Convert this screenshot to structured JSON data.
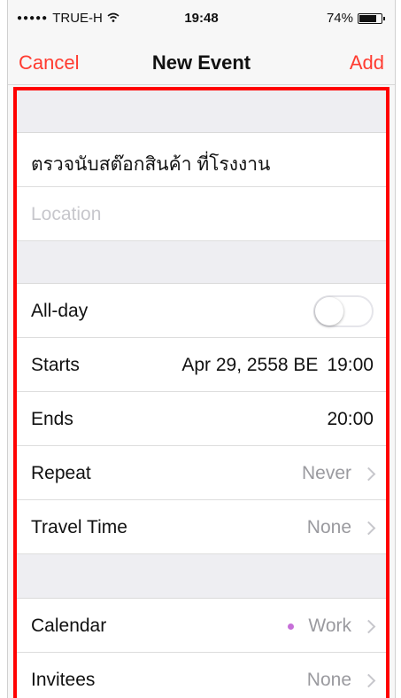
{
  "status_bar": {
    "carrier": "TRUE-H",
    "time": "19:48",
    "battery_percent": "74%",
    "battery_level": 0.74
  },
  "nav": {
    "cancel": "Cancel",
    "title": "New Event",
    "add": "Add"
  },
  "event": {
    "title": "ตรวจนับสต๊อกสินค้า ที่โรงงาน",
    "location_placeholder": "Location"
  },
  "fields": {
    "allday": {
      "label": "All-day",
      "toggle_on": false
    },
    "starts": {
      "label": "Starts",
      "date": "Apr 29, 2558 BE",
      "time": "19:00"
    },
    "ends": {
      "label": "Ends",
      "time": "20:00"
    },
    "repeat": {
      "label": "Repeat",
      "value": "Never"
    },
    "travel": {
      "label": "Travel Time",
      "value": "None"
    },
    "calendar": {
      "label": "Calendar",
      "value": "Work",
      "dot_color": "#c66fd8"
    },
    "invitees": {
      "label": "Invitees",
      "value": "None"
    }
  },
  "colors": {
    "accent": "#ff3b30",
    "highlight_border": "#ff0000"
  }
}
